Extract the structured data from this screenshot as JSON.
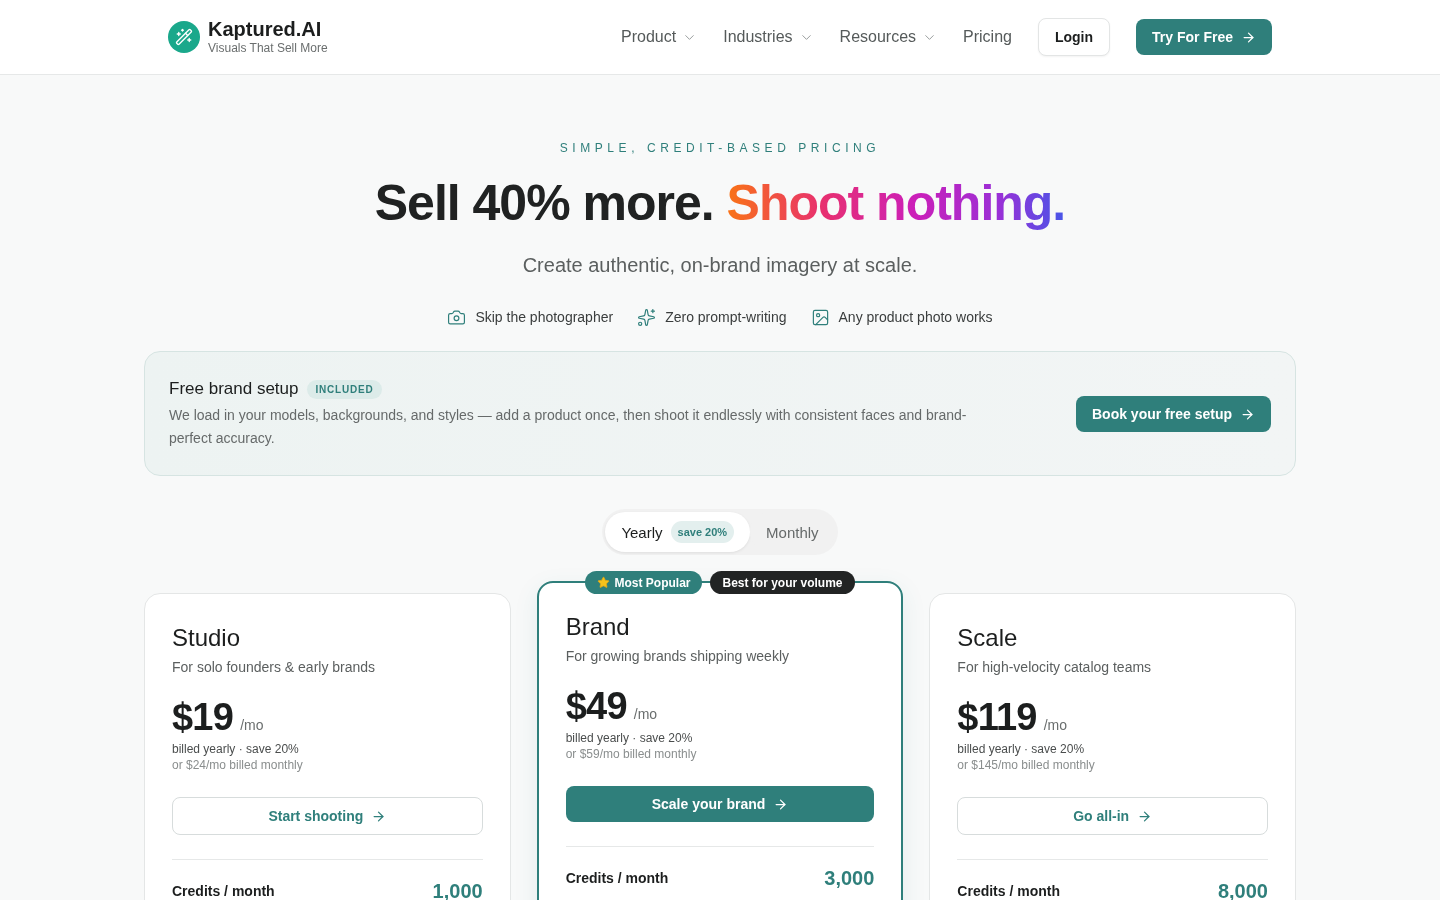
{
  "header": {
    "brand": {
      "name": "Kaptured.AI",
      "tagline": "Visuals That Sell More"
    },
    "nav": [
      {
        "label": "Product",
        "dropdown": true
      },
      {
        "label": "Industries",
        "dropdown": true
      },
      {
        "label": "Resources",
        "dropdown": true
      },
      {
        "label": "Pricing",
        "dropdown": false
      }
    ],
    "login": "Login",
    "cta": "Try For Free"
  },
  "hero": {
    "eyebrow": "SIMPLE, CREDIT-BASED PRICING",
    "headline": "Sell 40% more.",
    "headline_accent": "Shoot nothing.",
    "subtitle": "Create authentic, on-brand imagery at scale.",
    "features": [
      {
        "kind": "camera",
        "label": "Skip the photographer"
      },
      {
        "kind": "sparkles",
        "label": "Zero prompt-writing"
      },
      {
        "kind": "image",
        "label": "Any product photo works"
      }
    ]
  },
  "setup_banner": {
    "title": "Free brand setup",
    "badge": "INCLUDED",
    "text": "We load in your models, backgrounds, and styles — add a product once, then shoot it endlessly with consistent faces and brand-perfect accuracy.",
    "button": "Book your free setup"
  },
  "billing_toggle": {
    "options": [
      {
        "label": "Yearly",
        "badge": "save 20%",
        "selected": true
      },
      {
        "label": "Monthly",
        "selected": false
      }
    ]
  },
  "plans": [
    {
      "name": "Studio",
      "description": "For solo founders & early brands",
      "price": "$19",
      "period": "/mo",
      "billing": "billed yearly · save 20%",
      "alt_price": "or $24/mo billed monthly",
      "button": "Start shooting",
      "featured": false,
      "credits_label": "Credits / month",
      "credits": "1,000"
    },
    {
      "name": "Brand",
      "badges": [
        {
          "kind": "popular",
          "label": "Most Popular"
        },
        {
          "kind": "volume",
          "label": "Best for your volume"
        }
      ],
      "description": "For growing brands shipping weekly",
      "price": "$49",
      "period": "/mo",
      "billing": "billed yearly · save 20%",
      "alt_price": "or $59/mo billed monthly",
      "button": "Scale your brand",
      "featured": true,
      "credits_label": "Credits / month",
      "credits": "3,000"
    },
    {
      "name": "Scale",
      "description": "For high-velocity catalog teams",
      "price": "$119",
      "period": "/mo",
      "billing": "billed yearly · save 20%",
      "alt_price": "or $145/mo billed monthly",
      "button": "Go all-in",
      "featured": false,
      "credits_label": "Credits / month",
      "credits": "8,000"
    }
  ]
}
